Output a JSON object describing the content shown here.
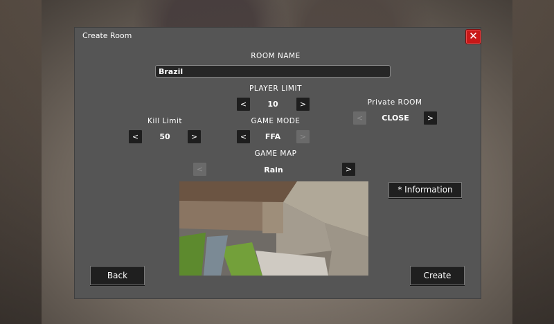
{
  "dialog": {
    "title": "Create Room",
    "close_icon": "✕"
  },
  "room_name": {
    "label": "ROOM NAME",
    "value": "Brazil"
  },
  "player_limit": {
    "label": "PLAYER LIMIT",
    "value": "10"
  },
  "private_room": {
    "label": "Private ROOM",
    "value": "CLOSE"
  },
  "kill_limit": {
    "label": "Kill Limit",
    "value": "50"
  },
  "game_mode": {
    "label": "GAME MODE",
    "value": "FFA"
  },
  "game_map": {
    "label": "GAME MAP",
    "value": "Rain"
  },
  "arrows": {
    "left": "<",
    "right": ">"
  },
  "buttons": {
    "information": "* Information",
    "back": "Back",
    "create": "Create"
  }
}
